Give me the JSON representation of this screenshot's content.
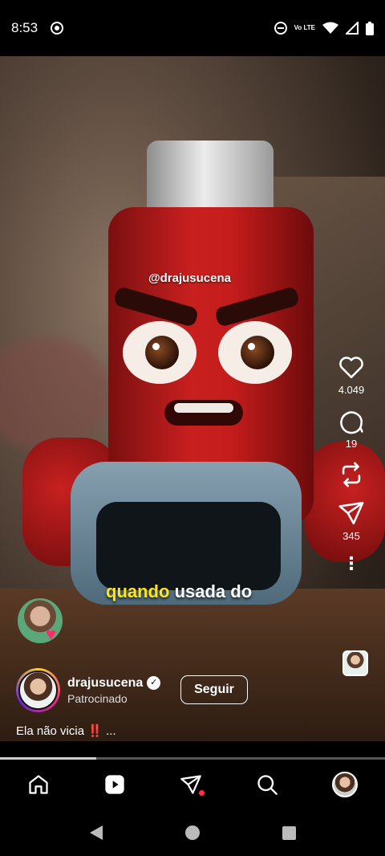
{
  "status": {
    "time": "8:53",
    "network": "Vo LTE"
  },
  "reel": {
    "watermark": "@drajusucena",
    "overlay_highlight": "quando",
    "overlay_text": "usada do"
  },
  "actions": {
    "likes": "4.049",
    "comments": "19",
    "shares": "345"
  },
  "author": {
    "username": "drajusucena",
    "sponsored_label": "Patrocinado",
    "follow_label": "Seguir"
  },
  "caption": {
    "text": "Ela não vicia",
    "emphasis": "‼️",
    "more": "..."
  },
  "progress": {
    "fraction": 0.25
  },
  "colors": {
    "highlight": "#ffe617",
    "notification_dot": "#ff3040",
    "caption_emphasis": "#e81d1d"
  },
  "icons": {
    "tabs": [
      "home-icon",
      "reels-icon",
      "messages-icon",
      "search-icon",
      "profile-avatar"
    ],
    "actions": [
      "heart-icon",
      "comment-icon",
      "repost-icon",
      "share-icon",
      "more-icon"
    ]
  }
}
